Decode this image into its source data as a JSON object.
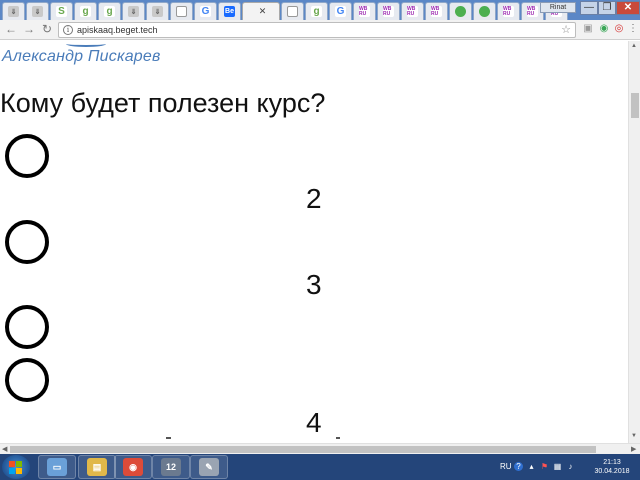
{
  "browser": {
    "url": "apiskaaq.beget.tech",
    "user": "Rinat",
    "tabs": [
      {
        "icon": "download-icon",
        "glyph": "⇓"
      },
      {
        "icon": "download-icon",
        "glyph": "⇓"
      },
      {
        "icon": "s-icon",
        "glyph": "S"
      },
      {
        "icon": "g-icon",
        "glyph": "g"
      },
      {
        "icon": "g-icon",
        "glyph": "g"
      },
      {
        "icon": "download-icon",
        "glyph": "⇓"
      },
      {
        "icon": "download-icon",
        "glyph": "⇓"
      },
      {
        "icon": "document-icon",
        "glyph": ""
      },
      {
        "icon": "google-icon",
        "glyph": "G"
      },
      {
        "icon": "behance-icon",
        "glyph": "Be"
      },
      {
        "icon": "active-tab",
        "glyph": ""
      },
      {
        "icon": "document-icon",
        "glyph": ""
      },
      {
        "icon": "g-icon",
        "glyph": "g"
      },
      {
        "icon": "google-icon",
        "glyph": "G"
      },
      {
        "icon": "wb-icon",
        "glyph": "WB RU"
      },
      {
        "icon": "wb-icon",
        "glyph": "WB RU"
      },
      {
        "icon": "wb-icon",
        "glyph": "WB RU"
      },
      {
        "icon": "wb-icon",
        "glyph": "WB RU"
      },
      {
        "icon": "earth-icon",
        "glyph": ""
      },
      {
        "icon": "earth-icon",
        "glyph": ""
      },
      {
        "icon": "wb-icon",
        "glyph": "WB RU"
      },
      {
        "icon": "wb-icon",
        "glyph": "WB RU"
      },
      {
        "icon": "wb-icon",
        "glyph": "WB RU"
      }
    ],
    "window_controls": {
      "minimize": "—",
      "maximize": "❐",
      "close": "✕"
    }
  },
  "page": {
    "logo": "Александр Пискарев",
    "heading": "Кому будет полезен курс?",
    "numbers": [
      "2",
      "3",
      "4"
    ]
  },
  "taskbar": {
    "apps": [
      {
        "name": "window-switcher",
        "glyph": "▭",
        "color": "#6aa0d8"
      },
      {
        "name": "file-explorer",
        "glyph": "▤",
        "color": "#e0b84a"
      },
      {
        "name": "chrome",
        "glyph": "◉",
        "color": "#dd4b39"
      },
      {
        "name": "webinar",
        "glyph": "12",
        "color": "#6b7a8f"
      },
      {
        "name": "tool",
        "glyph": "✎",
        "color": "#9aa4b2"
      }
    ],
    "language": "RU",
    "time": "21:13",
    "date": "30.04.2018"
  },
  "colors": {
    "tabstrip": "#5b87c6",
    "logo": "#4a7cb9",
    "taskbar": "#24457a"
  }
}
